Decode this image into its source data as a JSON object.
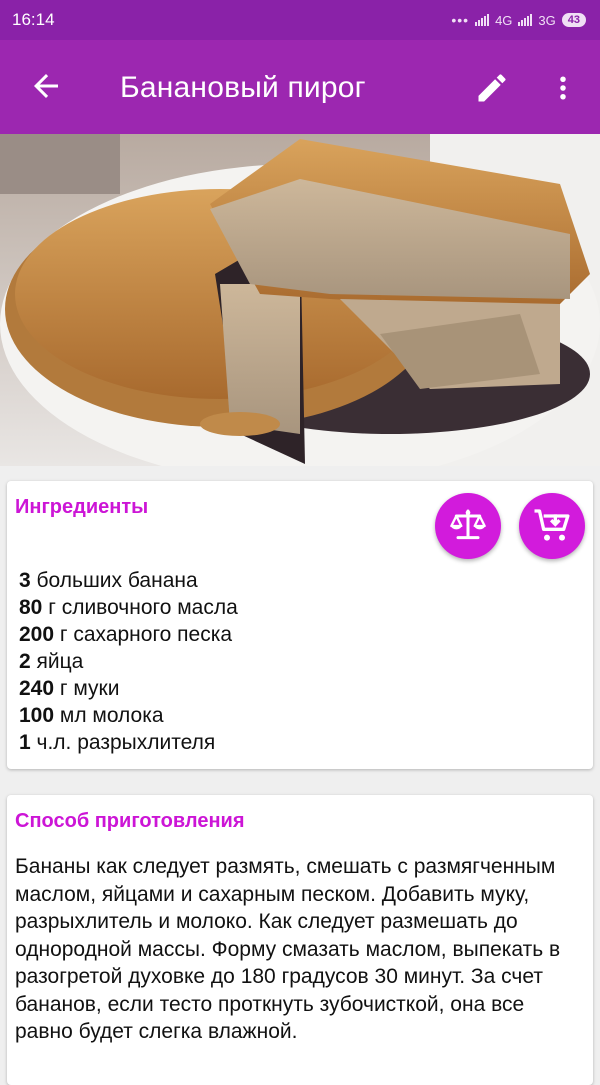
{
  "status_bar": {
    "time": "16:14",
    "dots": "•••",
    "network_1": "4G",
    "network_2": "3G",
    "battery": "43"
  },
  "app_bar": {
    "title": "Банановый пирог",
    "back_icon": "arrow-back-icon",
    "edit_icon": "pencil-icon",
    "more_icon": "more-vert-icon"
  },
  "colors": {
    "primary": "#9c27b0",
    "status_bar": "#8a22a8",
    "accent": "#d21bdc",
    "section_title": "#cc15d6"
  },
  "ingredients": {
    "title": "Ингредиенты",
    "scale_icon": "scale-balance-icon",
    "cart_icon": "cart-download-icon",
    "items": [
      {
        "amount": "3",
        "text": " больших банана"
      },
      {
        "amount": "80",
        "text": " г сливочного масла"
      },
      {
        "amount": "200",
        "text": " г сахарного песка"
      },
      {
        "amount": "2",
        "text": " яйца"
      },
      {
        "amount": "240",
        "text": " г муки"
      },
      {
        "amount": "100",
        "text": " мл молока"
      },
      {
        "amount": "1",
        "text": " ч.л. разрыхлителя"
      }
    ]
  },
  "method": {
    "title": "Способ приготовления",
    "text": "Бананы как следует размять, смешать с размягченным маслом, яйцами и сахарным песком. Добавить муку, разрыхлитель и молоко. Как следует размешать до однородной массы. Форму смазать маслом, выпекать в разогретой духовке до 180 градусов 30 минут. За счет бананов, если тесто проткнуть зубочисткой, она все равно будет слегка влажной."
  }
}
